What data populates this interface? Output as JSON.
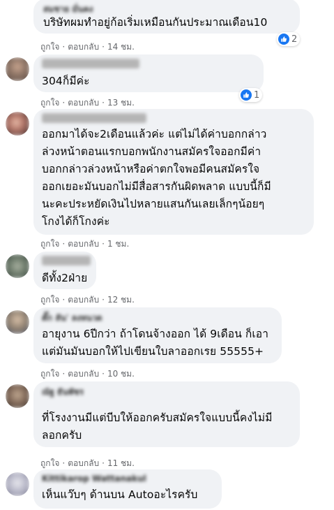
{
  "accent_color": "#1877f2",
  "comments": [
    {
      "name": "สมชาย มั่นคง",
      "text": "บริษัทผมทำอยู่ก้อเริ่มเหมือนกันประมาณเดือน10",
      "like": "ถูกใจ",
      "reply": "ตอบกลับ",
      "time": "14 ชม.",
      "reaction_count": "2"
    },
    {
      "text": "304ก็มีค่ะ",
      "like": "ถูกใจ",
      "reply": "ตอบกลับ",
      "time": "13 ชม.",
      "reaction_count": "1"
    },
    {
      "text": "ออกมาได้จะ2เดือนแล้วค่ะ แต่ไม่ได้ค่าบอกกล่าว\nล่วงหน้าตอนแรกบอกพนักงานสมัครใจออกมีค่า\nบอกกล่าวล่วงหน้าหรือค่าตกใจพอมีคนสมัครใจ\nออกเยอะมันบอกไม่มีสื่อสารกันผิดพลาด แบบนี้ก็มี\nนะคะประหยัดเงินไปหลายแสนกันเลยเล็กๆน้อยๆ\nโกงได้ก็โกงค่ะ",
      "like": "ถูกใจ",
      "reply": "ตอบกลับ",
      "time": "1 ชม."
    },
    {
      "name": "สมศักดิ์ ใจดี",
      "text": "ดีทั้ง2ฝ่าย",
      "like": "ถูกใจ",
      "reply": "ตอบกลับ",
      "time": "12 ชม."
    },
    {
      "name": "ตั๊ก ลัน' ลงหนวด",
      "text": "อายุงาน 6ปีกว่า ถ้าโดนจ้างออก ได้ 9เดือน ก็เอา\nแต่มันมันบอกให้ไปเขียนใบลาออกเรย 55555+",
      "like": "ถูกใจ",
      "reply": "ตอบกลับ",
      "time": "10 ชม."
    },
    {
      "name": "ณัฐ ธันพัชร",
      "text": "ที่โรงงานมีแต่บีบให้ออกครับสมัครใจแบบนี้คงไม่มี\nลอกครับ",
      "like": "ถูกใจ",
      "reply": "ตอบกลับ",
      "time": "11 ชม."
    },
    {
      "name": "Kittikarop Wattanakul",
      "text": "เห็นแว๊บๆ ด้านบน Autoอะไรครับ"
    }
  ]
}
